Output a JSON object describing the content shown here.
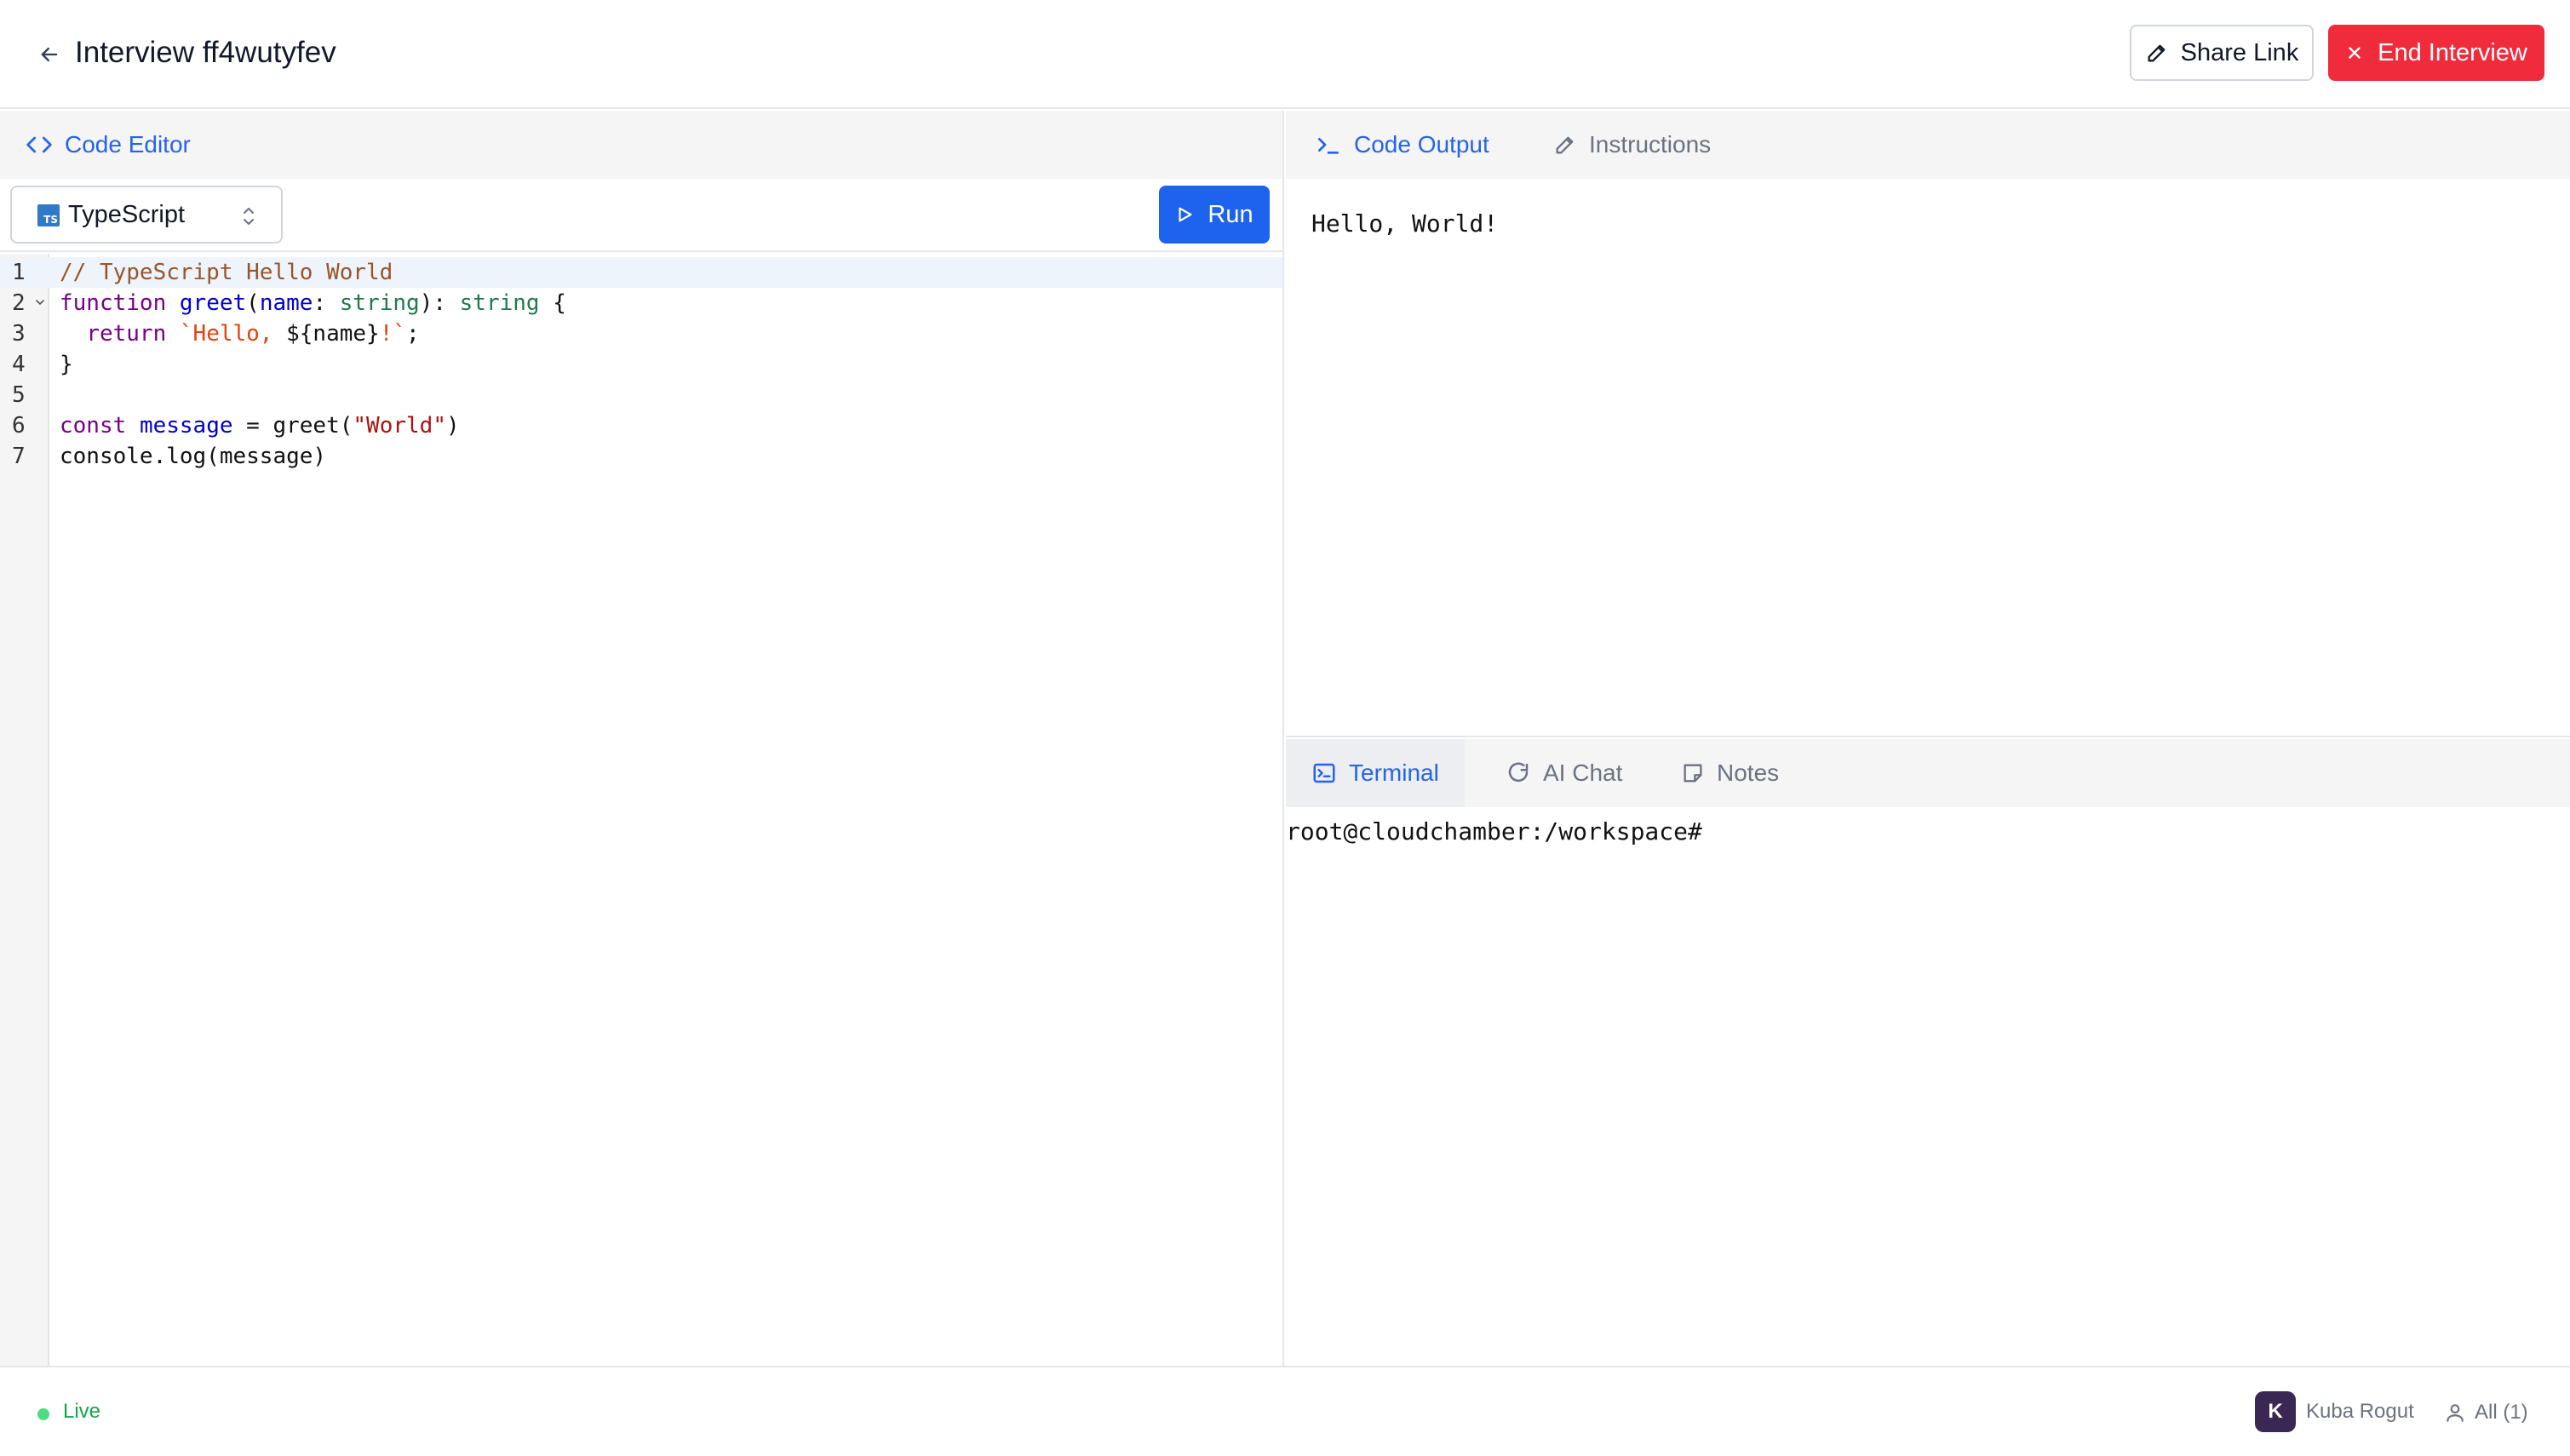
{
  "header": {
    "title": "Interview ff4wutyfev",
    "share_label": "Share Link",
    "end_label": "End Interview"
  },
  "editor": {
    "tab_label": "Code Editor",
    "language": "TypeScript",
    "language_badge": "TS",
    "run_label": "Run",
    "line_numbers": [
      "1",
      "2",
      "3",
      "4",
      "5",
      "6",
      "7"
    ],
    "code": {
      "l1": "// TypeScript Hello World",
      "l2_kw": "function",
      "l2_fn": "greet",
      "l2_open": "(",
      "l2_param": "name",
      "l2_colon": ": ",
      "l2_type1": "string",
      "l2_ret": "): ",
      "l2_type2": "string",
      "l2_brace": " {",
      "l3_kw": "return",
      "l3_tpl_a": "`Hello, ",
      "l3_interp": "${name}",
      "l3_tpl_b": "!`",
      "l3_semi": ";",
      "l4": "}",
      "l6_kw": "const",
      "l6_var": "message",
      "l6_mid": " = greet(",
      "l6_str": "\"World\"",
      "l6_end": ")",
      "l7": "console.log(message)"
    }
  },
  "output": {
    "tabs": [
      "Code Output",
      "Instructions"
    ],
    "text": "Hello, World!"
  },
  "bottom_panel": {
    "tabs": [
      "Terminal",
      "AI Chat",
      "Notes"
    ],
    "terminal_prompt": "root@cloudchamber:/workspace#"
  },
  "footer": {
    "status": "Live",
    "user_initial": "K",
    "user_name": "Kuba Rogut",
    "participants": "All (1)"
  },
  "colors": {
    "primary": "#1d63ed",
    "danger": "#ef2b3c",
    "live": "#16a34a",
    "avatar": "#3b2753"
  },
  "icons": {
    "back": "arrow-left-icon",
    "share": "pencil-icon",
    "end": "close-icon",
    "code": "code-brackets-icon",
    "run": "play-icon",
    "output": "terminal-prompt-icon",
    "instructions": "pencil-icon",
    "terminal": "terminal-square-icon",
    "ai_chat": "chat-refresh-icon",
    "notes": "sticky-note-icon",
    "participants": "user-icon"
  }
}
